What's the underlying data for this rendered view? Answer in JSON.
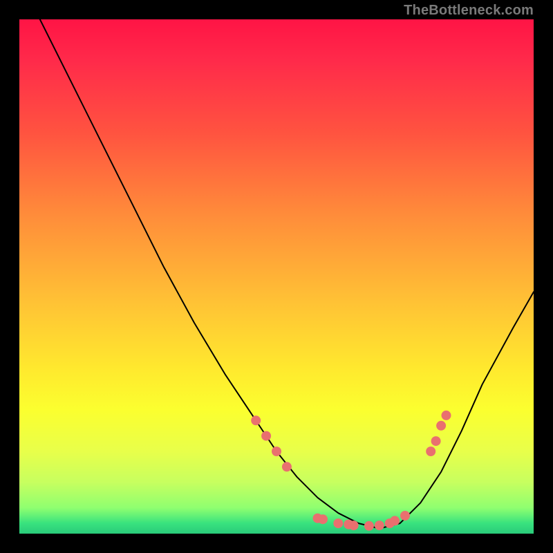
{
  "watermark": "TheBottleneck.com",
  "chart_data": {
    "type": "line",
    "title": "",
    "xlabel": "",
    "ylabel": "",
    "xlim": [
      0,
      100
    ],
    "ylim": [
      0,
      100
    ],
    "gradient_stops": [
      {
        "pct": 0,
        "color": "#ff1445"
      },
      {
        "pct": 8,
        "color": "#ff2a4a"
      },
      {
        "pct": 22,
        "color": "#ff5340"
      },
      {
        "pct": 38,
        "color": "#ff8c3a"
      },
      {
        "pct": 55,
        "color": "#ffc235"
      },
      {
        "pct": 68,
        "color": "#ffe92e"
      },
      {
        "pct": 76,
        "color": "#fbff2f"
      },
      {
        "pct": 84,
        "color": "#e8ff4a"
      },
      {
        "pct": 90,
        "color": "#c7ff5f"
      },
      {
        "pct": 95,
        "color": "#8fff70"
      },
      {
        "pct": 98,
        "color": "#38e27e"
      },
      {
        "pct": 100,
        "color": "#2acb7a"
      }
    ],
    "series": [
      {
        "name": "curve",
        "color": "#000000",
        "x": [
          4,
          10,
          16,
          22,
          28,
          34,
          40,
          46,
          50,
          54,
          58,
          62,
          66,
          70,
          74,
          78,
          82,
          86,
          90,
          96,
          100
        ],
        "y": [
          100,
          88,
          76,
          64,
          52,
          41,
          31,
          22,
          16,
          11,
          7,
          4,
          2,
          1,
          2,
          6,
          12,
          20,
          29,
          40,
          47
        ]
      }
    ],
    "markers": {
      "name": "highlight-points",
      "color": "#e9706f",
      "radius": 7,
      "points": [
        {
          "x": 46,
          "y": 22
        },
        {
          "x": 48,
          "y": 19
        },
        {
          "x": 50,
          "y": 16
        },
        {
          "x": 52,
          "y": 13
        },
        {
          "x": 58,
          "y": 3
        },
        {
          "x": 59,
          "y": 2.8
        },
        {
          "x": 62,
          "y": 2
        },
        {
          "x": 64,
          "y": 1.8
        },
        {
          "x": 65,
          "y": 1.6
        },
        {
          "x": 68,
          "y": 1.5
        },
        {
          "x": 70,
          "y": 1.6
        },
        {
          "x": 72,
          "y": 2
        },
        {
          "x": 73,
          "y": 2.5
        },
        {
          "x": 75,
          "y": 3.5
        },
        {
          "x": 80,
          "y": 16
        },
        {
          "x": 81,
          "y": 18
        },
        {
          "x": 82,
          "y": 21
        },
        {
          "x": 83,
          "y": 23
        }
      ]
    }
  }
}
